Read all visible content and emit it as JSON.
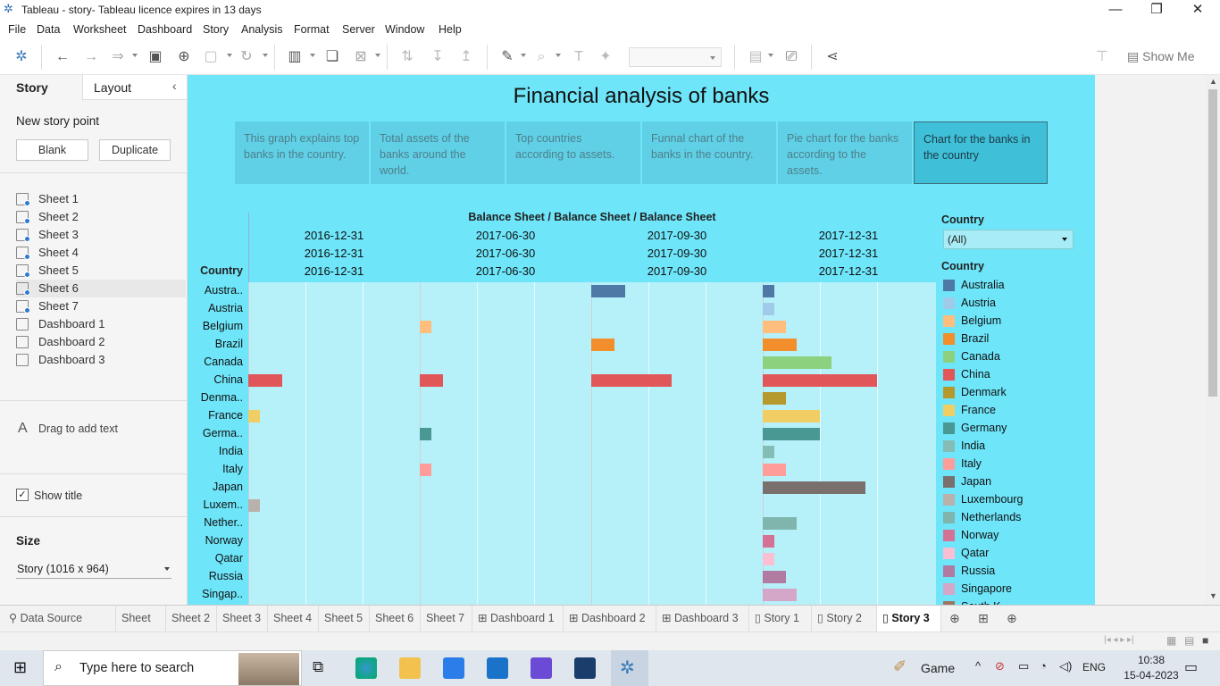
{
  "window": {
    "title": "Tableau - story- Tableau licence expires in 13 days",
    "minimize": "—",
    "restore": "❐",
    "close": "✕"
  },
  "menu": [
    "File",
    "Data",
    "Worksheet",
    "Dashboard",
    "Story",
    "Analysis",
    "Format",
    "Server",
    "Window",
    "Help"
  ],
  "toolbar": {
    "show_me": "Show Me"
  },
  "left_panel": {
    "tab_story": "Story",
    "tab_layout": "Layout",
    "new_story_point": "New story point",
    "blank_button": "Blank",
    "duplicate_button": "Duplicate",
    "sheets": [
      "Sheet 1",
      "Sheet 2",
      "Sheet 3",
      "Sheet 4",
      "Sheet 5",
      "Sheet 6",
      "Sheet 7"
    ],
    "dashboards": [
      "Dashboard 1",
      "Dashboard 2",
      "Dashboard 3"
    ],
    "drag_text": "Drag to add text",
    "show_title": "Show title",
    "size_label": "Size",
    "size_value": "Story (1016 x 964)"
  },
  "story": {
    "title": "Financial analysis of banks",
    "points": [
      "This graph explains top banks in the country.",
      "Total assets of the banks around the world.",
      "Top countries according to assets.",
      "Funnal chart of the banks in the country.",
      "Pie chart for the banks according to the assets.",
      "Chart for the banks in the country"
    ],
    "active_point": 5
  },
  "chart_data": {
    "type": "bar",
    "header": "Balance Sheet / Balance Sheet / Balance Sheet",
    "row_header": "Country",
    "columns": [
      "2016-12-31",
      "2017-06-30",
      "2017-09-30",
      "2017-12-31"
    ],
    "categories": [
      "Austra..",
      "Austria",
      "Belgium",
      "Brazil",
      "Canada",
      "China",
      "Denma..",
      "France",
      "Germa..",
      "India",
      "Italy",
      "Japan",
      "Luxem..",
      "Nether..",
      "Norway",
      "Qatar",
      "Russia",
      "Singap.."
    ],
    "series": [
      {
        "values": [
          0,
          0,
          0,
          0,
          0,
          3,
          0,
          1,
          0,
          0,
          0,
          0,
          1,
          0,
          0,
          0,
          0,
          0
        ]
      },
      {
        "values": [
          0,
          0,
          1,
          0,
          0,
          2,
          0,
          0,
          1,
          0,
          1,
          0,
          0,
          0,
          0,
          0,
          0,
          0
        ]
      },
      {
        "values": [
          3,
          0,
          0,
          2,
          0,
          7,
          0,
          0,
          0,
          0,
          0,
          0,
          0,
          0,
          0,
          0,
          0,
          0
        ]
      },
      {
        "values": [
          1,
          1,
          2,
          3,
          6,
          10,
          2,
          5,
          5,
          1,
          2,
          9,
          0,
          3,
          1,
          1,
          2,
          3
        ]
      }
    ],
    "xlim": [
      0,
      15
    ],
    "grid": true
  },
  "legend": {
    "filter_title": "Country",
    "filter_value": "(All)",
    "title": "Country",
    "items": [
      {
        "name": "Australia",
        "color": "#4e79a7"
      },
      {
        "name": "Austria",
        "color": "#a0cbe8"
      },
      {
        "name": "Belgium",
        "color": "#ffbe7d"
      },
      {
        "name": "Brazil",
        "color": "#f28e2b"
      },
      {
        "name": "Canada",
        "color": "#8cd17d"
      },
      {
        "name": "China",
        "color": "#e15759"
      },
      {
        "name": "Denmark",
        "color": "#b6992d"
      },
      {
        "name": "France",
        "color": "#f1ce63"
      },
      {
        "name": "Germany",
        "color": "#499894"
      },
      {
        "name": "India",
        "color": "#86bcb6"
      },
      {
        "name": "Italy",
        "color": "#ff9d9a"
      },
      {
        "name": "Japan",
        "color": "#79706e"
      },
      {
        "name": "Luxembourg",
        "color": "#bab0ac"
      },
      {
        "name": "Netherlands",
        "color": "#7fb5ad"
      },
      {
        "name": "Norway",
        "color": "#d37295"
      },
      {
        "name": "Qatar",
        "color": "#fabfd2"
      },
      {
        "name": "Russia",
        "color": "#b07aa1"
      },
      {
        "name": "Singapore",
        "color": "#d4a6c8"
      },
      {
        "name": "South K..",
        "color": "#9d7660"
      }
    ]
  },
  "bottom_tabs": [
    "Data Source",
    "Sheet 1",
    "Sheet 2",
    "Sheet 3",
    "Sheet 4",
    "Sheet 5",
    "Sheet 6",
    "Sheet 7",
    "Dashboard 1",
    "Dashboard 2",
    "Dashboard 3",
    "Story 1",
    "Story 2",
    "Story 3"
  ],
  "taskbar": {
    "search_placeholder": "Type here to search",
    "game_label": "Game",
    "lang": "ENG",
    "time": "10:38",
    "date": "15-04-2023"
  }
}
